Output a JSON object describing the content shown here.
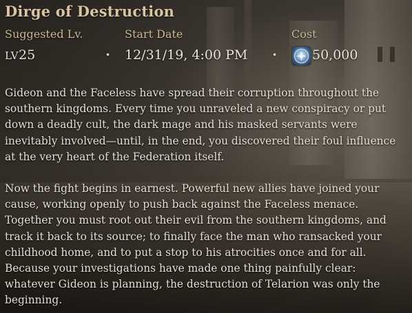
{
  "quest": {
    "title": "Dirge of Destruction",
    "suggested_level_label": "Suggested Lv.",
    "suggested_level_prefix": "LV",
    "suggested_level_value": "25",
    "start_date_label": "Start Date",
    "start_date_value": "12/31/19, 4:00 PM",
    "cost_label": "Cost",
    "cost_value": "50,000",
    "cost_icon": "silver-coin-icon",
    "separator": "•"
  },
  "description": {
    "paragraph_1": "Gideon and the Faceless have spread their corruption throughout the southern kingdoms. Every time you unraveled a new conspiracy or put down a deadly cult, the dark mage and his masked servants were inevitably involved—until, in the end, you discovered their foul influence at the very heart of the Federation itself.",
    "paragraph_2": "Now the fight begins in earnest. Powerful new allies have joined your cause, working openly to push back against the Faceless menace. Together you must root out their evil from the southern kingdoms, and track it back to its source; to finally face the man who ransacked your childhood home, and to put a stop to his atrocities once and for all. Because your investigations have made one thing painfully clear: whatever Gideon is planning, the destruction of Telarion was only the beginning."
  },
  "colors": {
    "title": "#d9c6a0",
    "label": "#cdb893",
    "text": "#e4dfd5"
  }
}
